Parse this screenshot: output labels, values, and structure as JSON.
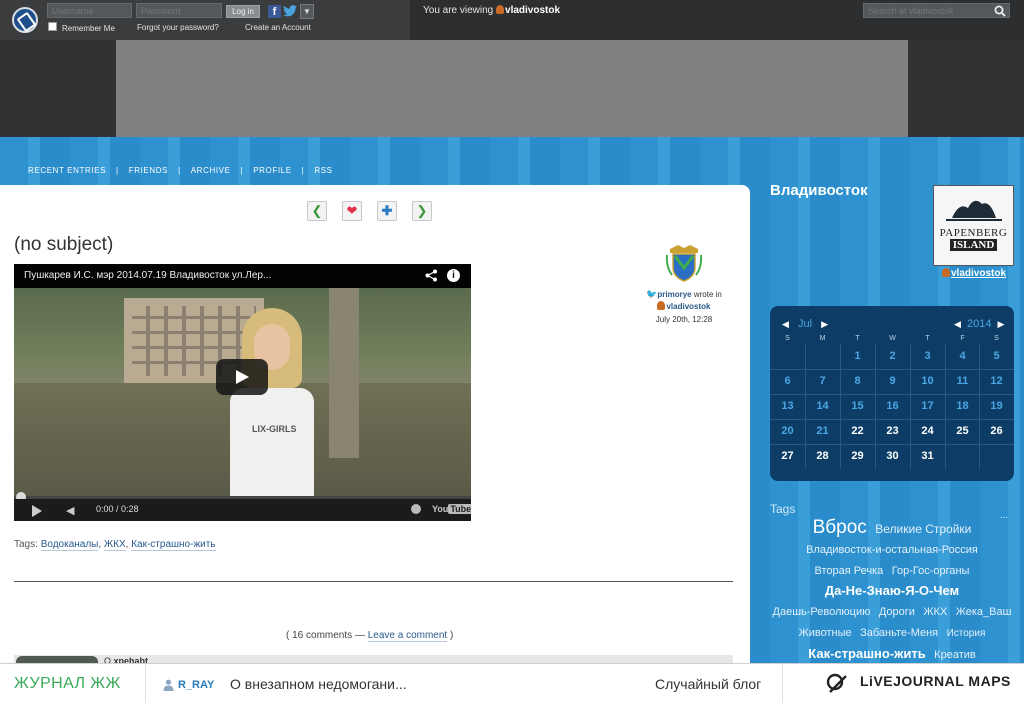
{
  "topbar": {
    "username_placeholder": "Username",
    "password_placeholder": "Password",
    "login_label": "Log in",
    "remember_me": "Remember Me",
    "forgot_password": "Forgot your password?",
    "create_account": "Create an Account",
    "viewing_prefix": "You are viewing",
    "viewing_user": "vladivostok",
    "search_placeholder": "Search at vladivostok"
  },
  "nav": {
    "items": [
      "RECENT ENTRIES",
      "FRIENDS",
      "ARCHIVE",
      "PROFILE",
      "RSS"
    ],
    "separator": "|"
  },
  "post": {
    "title": "(no subject)",
    "video_title": "Пушкарев И.С. мэр 2014.07.19 Владивосток ул.Лер...",
    "video_time": "0:00 / 0:28",
    "video_shirt_text": "LIX-GIRLS",
    "youtube_label": "You",
    "youtube_label2": "Tube",
    "author": "primorye",
    "wrote_in": "wrote in",
    "community": "vladivostok",
    "date": "July 20th, 12:28",
    "tags_label": "Tags:",
    "tags": [
      "Водоканалы",
      "ЖКХ",
      "Как-страшно-жить"
    ],
    "comments_open": "(",
    "comments_count": "16 comments",
    "comments_dash": "—",
    "leave_comment": "Leave a comment",
    "comments_close": ")",
    "commenter_initial": "Q",
    "commenter": "xpehabt"
  },
  "sidebar": {
    "title": "Владивосток",
    "userpic_line1": "PAPENBERG",
    "userpic_line2": "ISLAND",
    "user": "vladivostok",
    "calendar": {
      "month": "Jul",
      "year": "2014",
      "weekdays": [
        "S",
        "M",
        "T",
        "W",
        "T",
        "F",
        "S"
      ],
      "weeks": [
        [
          "",
          "",
          "1",
          "2",
          "3",
          "4",
          "5"
        ],
        [
          "6",
          "7",
          "8",
          "9",
          "10",
          "11",
          "12"
        ],
        [
          "13",
          "14",
          "15",
          "16",
          "17",
          "18",
          "19"
        ],
        [
          "20",
          "21",
          "22",
          "23",
          "24",
          "25",
          "26"
        ],
        [
          "27",
          "28",
          "29",
          "30",
          "31",
          "",
          ""
        ]
      ],
      "linked_days": [
        "1",
        "2",
        "3",
        "4",
        "5",
        "6",
        "7",
        "8",
        "9",
        "10",
        "11",
        "12",
        "13",
        "14",
        "15",
        "16",
        "17",
        "18",
        "19",
        "20",
        "21"
      ]
    },
    "tags_title": "Tags",
    "tags_more": "...",
    "tag_cloud": [
      {
        "text": "Вброс",
        "size": "large"
      },
      {
        "text": "Великие Стройки",
        "size": "medium"
      },
      {
        "text": "Владивосток-и-остальная-Россия",
        "size": "small"
      },
      {
        "text": "Вторая Речка",
        "size": "small"
      },
      {
        "text": "Гор-Гос-органы",
        "size": "small"
      },
      {
        "text": "Да-Не-Знаю-Я-О-Чем",
        "size": "bold"
      },
      {
        "text": "Даешь-Революцию",
        "size": "small"
      },
      {
        "text": "Дороги",
        "size": "small"
      },
      {
        "text": "ЖКХ",
        "size": "small"
      },
      {
        "text": "Жека_Ваш",
        "size": "small"
      },
      {
        "text": "Животные",
        "size": "small"
      },
      {
        "text": "Забаньте-Меня",
        "size": "small"
      },
      {
        "text": "История",
        "size": "xsmall"
      },
      {
        "text": "Как-страшно-жить",
        "size": "bold"
      },
      {
        "text": "Креатив",
        "size": "small"
      }
    ]
  },
  "bottombar": {
    "brand": "ЖУРНАЛ ЖЖ",
    "user": "R_RAY",
    "post_title": "О внезапном недомогани...",
    "random_blog": "Случайный блог",
    "maps": "LiVEJOURNAL MAPS"
  },
  "colors": {
    "accent_blue": "#3398d4",
    "calendar_bg": "#0d3d66",
    "calendar_link": "#4aa7e4",
    "brand_green": "#3aaa5a"
  }
}
